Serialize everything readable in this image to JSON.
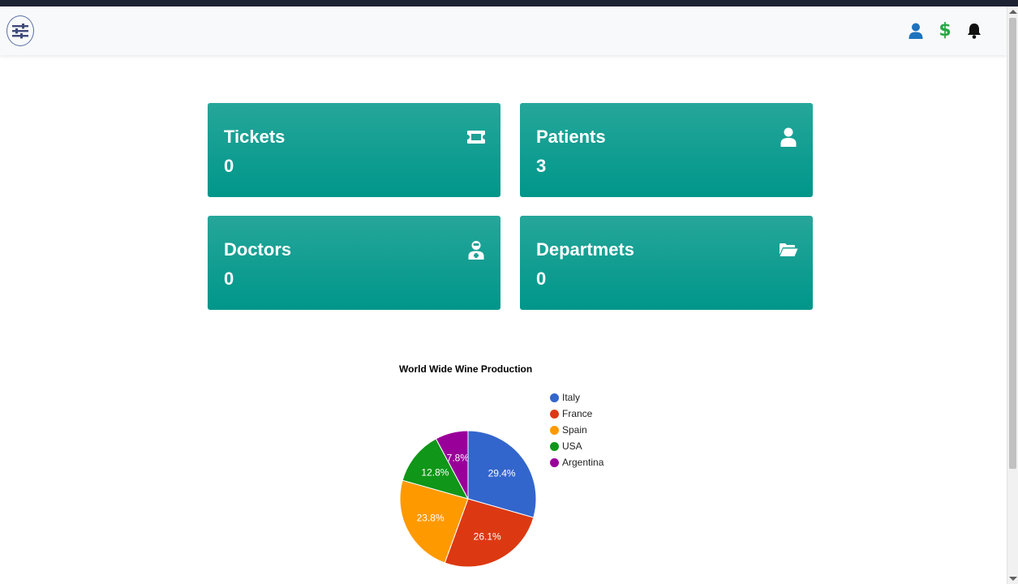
{
  "navbar": {
    "icons": [
      "sliders-icon",
      "user-icon",
      "dollar-icon",
      "bell-icon"
    ],
    "dollar_glyph": "$"
  },
  "cards": [
    {
      "title": "Tickets",
      "value": "0",
      "icon": "ticket-icon"
    },
    {
      "title": "Patients",
      "value": "3",
      "icon": "user-icon"
    },
    {
      "title": "Doctors",
      "value": "0",
      "icon": "doctor-icon"
    },
    {
      "title": "Departmets",
      "value": "0",
      "icon": "folder-open-icon"
    }
  ],
  "colors": {
    "card_accent": "#009688",
    "user_icon": "#1e73be",
    "dollar_icon": "#28a745",
    "bell_icon": "#111111"
  },
  "chart_data": {
    "type": "pie",
    "title": "World Wide Wine Production",
    "legend_position": "right",
    "slices": [
      {
        "label": "Italy",
        "value": 29.4,
        "display": "29.4%",
        "color": "#3366cc"
      },
      {
        "label": "France",
        "value": 26.1,
        "display": "26.1%",
        "color": "#dc3912"
      },
      {
        "label": "Spain",
        "value": 23.8,
        "display": "23.8%",
        "color": "#ff9900"
      },
      {
        "label": "USA",
        "value": 12.8,
        "display": "12.8%",
        "color": "#109618"
      },
      {
        "label": "Argentina",
        "value": 7.8,
        "display": "7.8%",
        "color": "#990099"
      }
    ]
  }
}
